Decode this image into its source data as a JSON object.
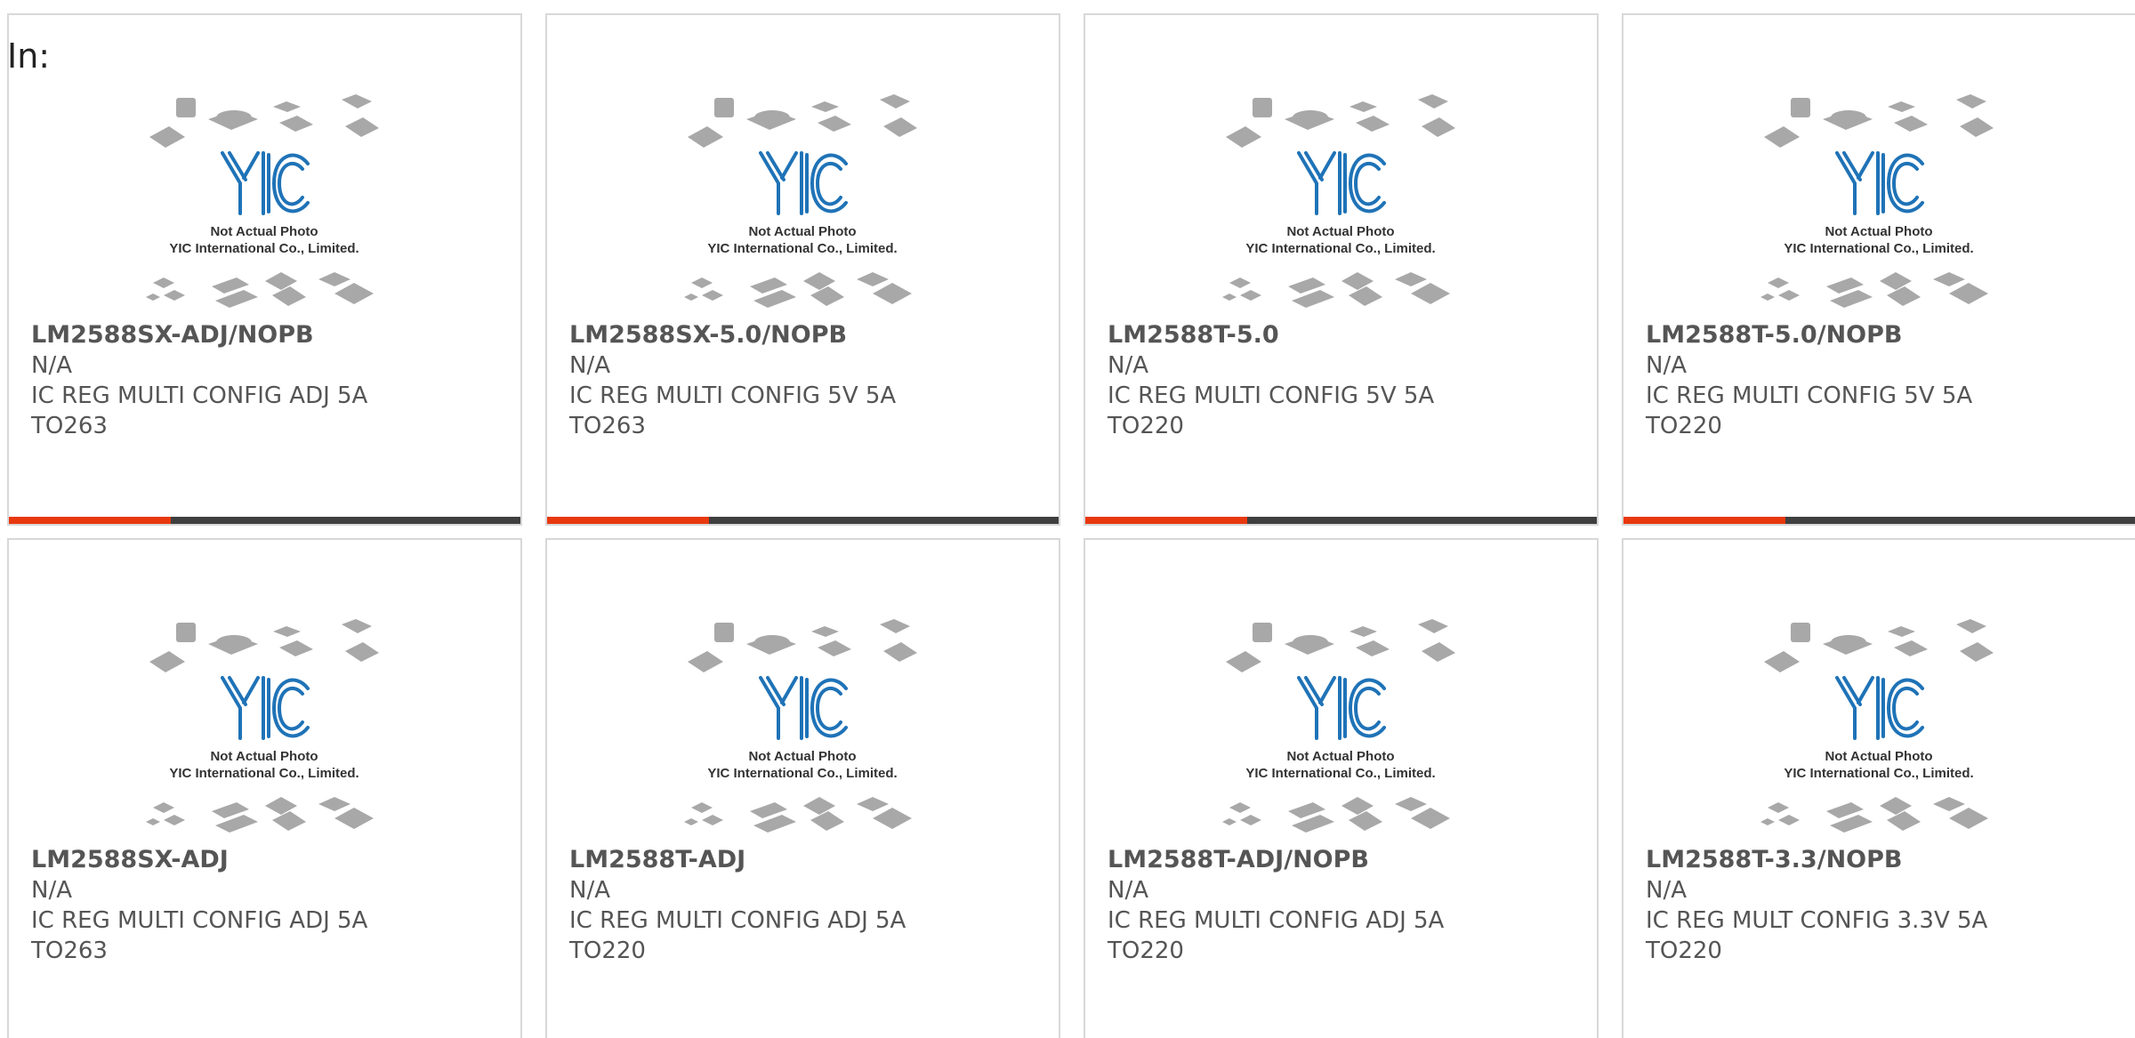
{
  "header": {
    "in_label": "In:"
  },
  "placeholder": {
    "line1": "Not Actual Photo",
    "line2": "YIC International Co., Limited.",
    "logo_text": "YIC",
    "logo_color": "#1f73b7",
    "chip_color": "#a8a8a8"
  },
  "colors": {
    "accent": "#e8380d",
    "bar": "#3f3f3f",
    "text": "#555555",
    "border": "#d8d8d8"
  },
  "products": [
    {
      "part": "LM2588SX-ADJ/NOPB",
      "manufacturer": "N/A",
      "description": "IC REG MULTI CONFIG ADJ 5A",
      "package": "TO263"
    },
    {
      "part": "LM2588SX-5.0/NOPB",
      "manufacturer": "N/A",
      "description": "IC REG MULTI CONFIG 5V 5A",
      "package": "TO263"
    },
    {
      "part": "LM2588T-5.0",
      "manufacturer": "N/A",
      "description": "IC REG MULTI CONFIG 5V 5A",
      "package": "TO220"
    },
    {
      "part": "LM2588T-5.0/NOPB",
      "manufacturer": "N/A",
      "description": "IC REG MULTI CONFIG 5V 5A",
      "package": "TO220"
    },
    {
      "part": "LM2588SX-ADJ",
      "manufacturer": "N/A",
      "description": "IC REG MULTI CONFIG ADJ 5A",
      "package": "TO263"
    },
    {
      "part": "LM2588T-ADJ",
      "manufacturer": "N/A",
      "description": "IC REG MULTI CONFIG ADJ 5A",
      "package": "TO220"
    },
    {
      "part": "LM2588T-ADJ/NOPB",
      "manufacturer": "N/A",
      "description": "IC REG MULTI CONFIG ADJ 5A",
      "package": "TO220"
    },
    {
      "part": "LM2588T-3.3/NOPB",
      "manufacturer": "N/A",
      "description": "IC REG MULT CONFIG 3.3V 5A",
      "package": "TO220"
    }
  ]
}
